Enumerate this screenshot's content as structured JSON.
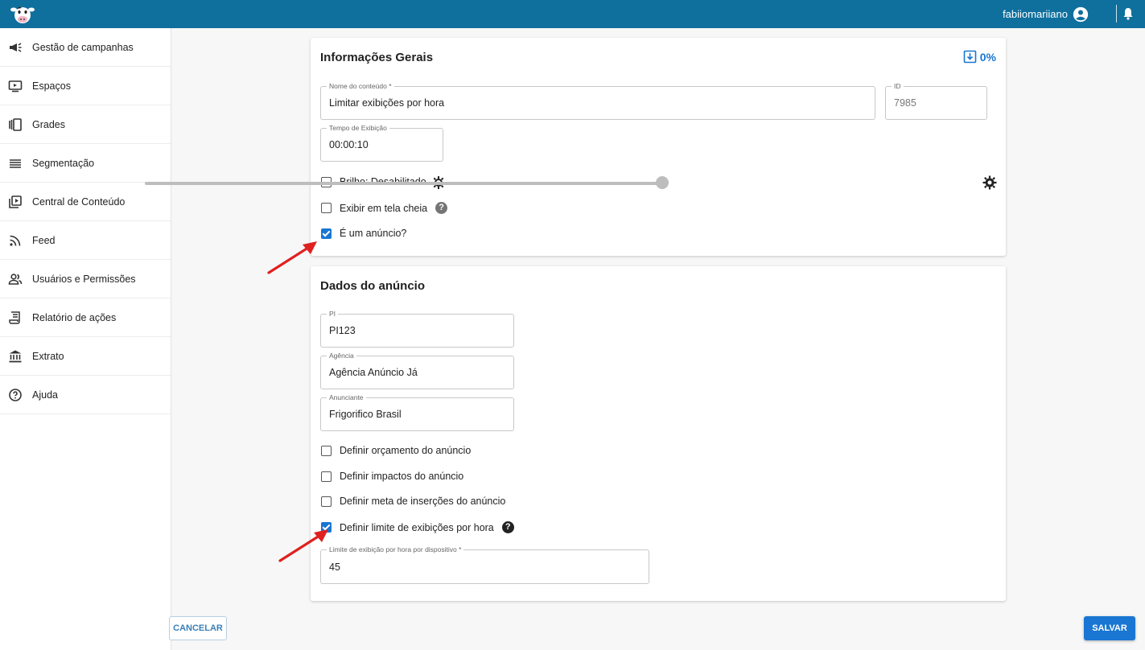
{
  "topbar": {
    "username": "fabiiomariiano",
    "logo_icon": "cow-logo-icon",
    "user_icon": "account-circle-icon",
    "bell_icon": "bell-icon",
    "background": "#0f6f9d"
  },
  "sidebar": {
    "items": [
      {
        "label": "Gestão de campanhas",
        "icon": "megaphone-icon"
      },
      {
        "label": "Espaços",
        "icon": "screen-icon"
      },
      {
        "label": "Grades",
        "icon": "carousel-icon"
      },
      {
        "label": "Segmentação",
        "icon": "list-icon"
      },
      {
        "label": "Central de Conteúdo",
        "icon": "video-library-icon"
      },
      {
        "label": "Feed",
        "icon": "rss-icon"
      },
      {
        "label": "Usuários e Permissões",
        "icon": "people-icon"
      },
      {
        "label": "Relatório de ações",
        "icon": "receipt-icon"
      },
      {
        "label": "Extrato",
        "icon": "bank-icon"
      },
      {
        "label": "Ajuda",
        "icon": "help-circle-icon"
      }
    ]
  },
  "general": {
    "title": "Informações Gerais",
    "progress": "0%",
    "content_name_label": "Nome do conteúdo *",
    "content_name_value": "Limitar exibições por hora",
    "id_label": "ID",
    "id_value": "7985",
    "duration_label": "Tempo de Exibição",
    "duration_value": "00:00:10",
    "brightness_label": "Brilho: Desabilitado",
    "brightness_checked": false,
    "fullscreen_label": "Exibir em tela cheia",
    "fullscreen_checked": false,
    "is_ad_label": "É um anúncio?",
    "is_ad_checked": true
  },
  "ad": {
    "title": "Dados do anúncio",
    "pi_label": "PI",
    "pi_value": "PI123",
    "agency_label": "Agência",
    "agency_value": "Agência Anúncio Já",
    "advertiser_label": "Anunciante",
    "advertiser_value": "Frigorifico Brasil",
    "budget_label": "Definir orçamento do anúncio",
    "budget_checked": false,
    "impacts_label": "Definir impactos do anúncio",
    "impacts_checked": false,
    "insertions_label": "Definir meta de inserções do anúncio",
    "insertions_checked": false,
    "hourly_limit_label": "Definir limite de exibições por hora",
    "hourly_limit_checked": true,
    "limit_field_label": "Limite de exibição por hora por dispositivo *",
    "limit_field_value": "45"
  },
  "actions": {
    "cancel_label": "CANCELAR",
    "save_label": "SALVAR"
  },
  "colors": {
    "primary": "#1976d2",
    "annotation_arrow": "#e02020"
  }
}
